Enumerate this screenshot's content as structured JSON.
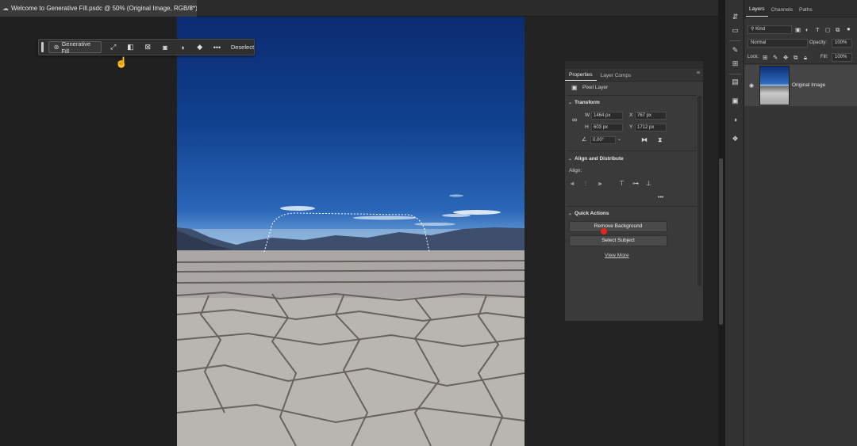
{
  "document_tab": {
    "title": "Welcome to Generative Fill.psdc @ 50% (Original Image, RGB/8*)"
  },
  "taskbar": {
    "generative_fill_label": "Generative Fill",
    "deselect_label": "Deselect",
    "more_label": "•••"
  },
  "properties": {
    "tab_properties": "Properties",
    "tab_layer_comps": "Layer Comps",
    "layer_type": "Pixel Layer",
    "transform": {
      "title": "Transform",
      "w_label": "W",
      "w_value": "1464 px",
      "x_label": "X",
      "x_value": "767 px",
      "h_label": "H",
      "h_value": "603 px",
      "y_label": "Y",
      "y_value": "1712 px",
      "angle_value": "0.00°"
    },
    "align": {
      "title": "Align and Distribute",
      "align_label": "Align:",
      "more": "•••"
    },
    "quick_actions": {
      "title": "Quick Actions",
      "remove_background": "Remove Background",
      "select_subject": "Select Subject",
      "view_more": "View More"
    }
  },
  "layers_panel": {
    "tab_layers": "Layers",
    "tab_channels": "Channels",
    "tab_paths": "Paths",
    "filter_kind": "Kind",
    "blend_mode": "Normal",
    "opacity_label": "Opacity:",
    "opacity_value": "100%",
    "lock_label": "Lock:",
    "fill_label": "Fill:",
    "fill_value": "100%",
    "layers": [
      {
        "name": "Original Image",
        "visible": true
      }
    ]
  },
  "colors": {
    "app_bg": "#1e1e1e",
    "panel_bg": "#3a3a3a",
    "highlight_dot": "#e0281a"
  }
}
